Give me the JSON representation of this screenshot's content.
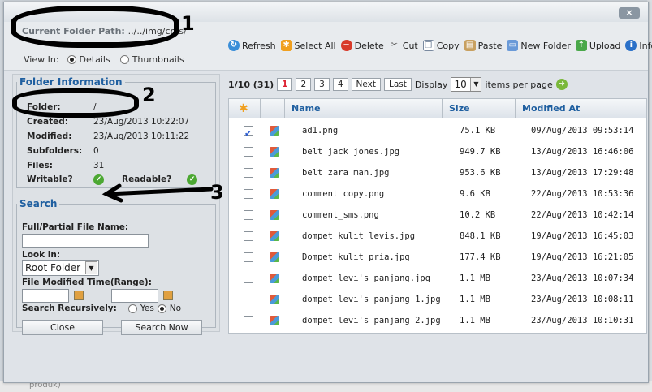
{
  "window": {
    "close_label": "×"
  },
  "header": {
    "path_label": "Current Folder Path:",
    "path_value": "../../img/cms/",
    "view_in_label": "View In:",
    "view_details": "Details",
    "view_thumbnails": "Thumbnails"
  },
  "toolbar": {
    "refresh": "Refresh",
    "select_all": "Select All",
    "delete": "Delete",
    "cut": "Cut",
    "copy": "Copy",
    "paste": "Paste",
    "new_folder": "New Folder",
    "upload": "Upload",
    "info": "Info"
  },
  "markers": {
    "m1": "1",
    "m2": "2",
    "m3": "3"
  },
  "folder_info": {
    "legend": "Folder Information",
    "folder_label": "Folder:",
    "folder_value": "/",
    "created_label": "Created:",
    "created_value": "23/Aug/2013 10:22:07",
    "modified_label": "Modified:",
    "modified_value": "23/Aug/2013 10:11:22",
    "subfolders_label": "Subfolders:",
    "subfolders_value": "0",
    "files_label": "Files:",
    "files_value": "31",
    "writable_label": "Writable?",
    "readable_label": "Readable?"
  },
  "search": {
    "legend": "Search",
    "name_label": "Full/Partial File Name:",
    "look_in_label": "Look in:",
    "look_in_value": "Root Folder",
    "modified_label": "File Modified Time(Range):",
    "recursive_label": "Search Recursively:",
    "yes": "Yes",
    "no": "No",
    "close_button": "Close",
    "search_button": "Search Now"
  },
  "pager": {
    "summary": "1/10 (31)",
    "pages": [
      "1",
      "2",
      "3",
      "4"
    ],
    "next": "Next",
    "last": "Last",
    "display_label": "Display",
    "per_page_value": "10",
    "per_page_label": "items per page"
  },
  "grid": {
    "headers": {
      "name": "Name",
      "size": "Size",
      "modified": "Modified At"
    },
    "rows": [
      {
        "name": "ad1.png",
        "size": "75.1 KB",
        "modified": "09/Aug/2013 09:53:14",
        "checked": true
      },
      {
        "name": "belt jack jones.jpg",
        "size": "949.7 KB",
        "modified": "13/Aug/2013 16:46:06",
        "checked": false
      },
      {
        "name": "belt zara man.jpg",
        "size": "953.6 KB",
        "modified": "13/Aug/2013 17:29:48",
        "checked": false
      },
      {
        "name": "comment copy.png",
        "size": "9.6 KB",
        "modified": "22/Aug/2013 10:53:36",
        "checked": false
      },
      {
        "name": "comment_sms.png",
        "size": "10.2 KB",
        "modified": "22/Aug/2013 10:42:14",
        "checked": false
      },
      {
        "name": "dompet kulit levis.jpg",
        "size": "848.1 KB",
        "modified": "19/Aug/2013 16:45:03",
        "checked": false
      },
      {
        "name": "Dompet kulit pria.jpg",
        "size": "177.4 KB",
        "modified": "19/Aug/2013 16:21:05",
        "checked": false
      },
      {
        "name": "dompet levi's panjang.jpg",
        "size": "1.1 MB",
        "modified": "23/Aug/2013 10:07:34",
        "checked": false
      },
      {
        "name": "dompet levi's panjang_1.jpg",
        "size": "1.1 MB",
        "modified": "23/Aug/2013 10:08:11",
        "checked": false
      },
      {
        "name": "dompet levi's panjang_2.jpg",
        "size": "1.1 MB",
        "modified": "23/Aug/2013 10:10:31",
        "checked": false
      }
    ]
  },
  "background": {
    "footer_text": "produk)"
  }
}
